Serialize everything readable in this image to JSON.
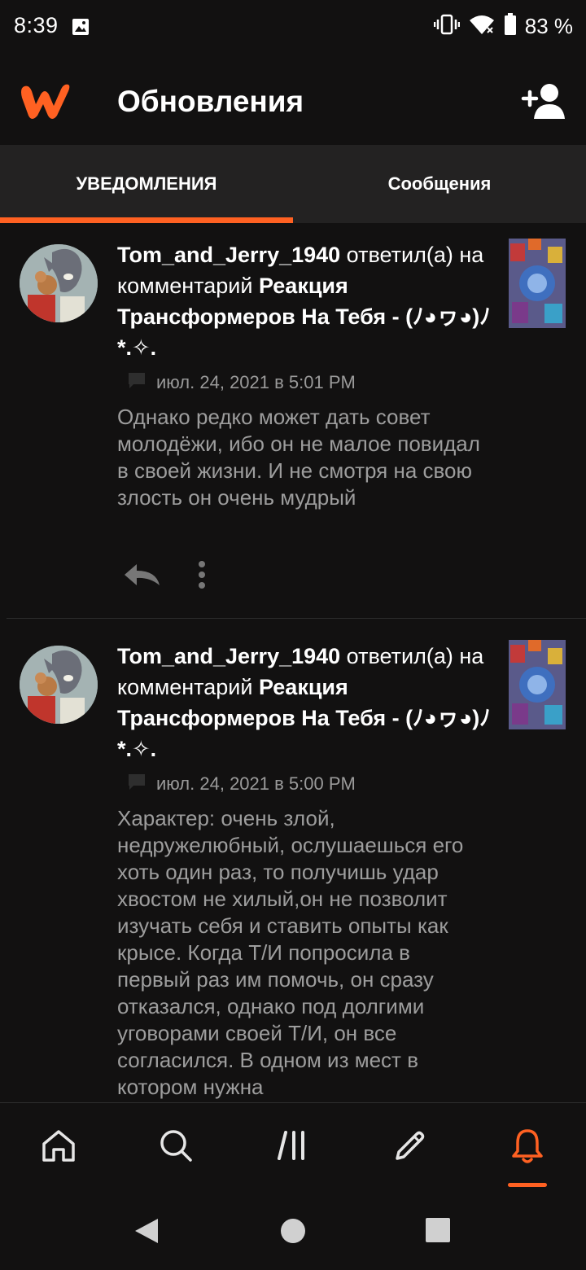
{
  "status_bar": {
    "time": "8:39",
    "battery": "83 %"
  },
  "app_bar": {
    "title": "Обновления",
    "logo_icon": "wattpad-logo",
    "action_icon": "add-user-icon"
  },
  "tabs": [
    {
      "label": "УВЕДОМЛЕНИЯ",
      "active": true
    },
    {
      "label": "Сообщения",
      "active": false
    }
  ],
  "notifications": [
    {
      "user": "Tom_and_Jerry_1940",
      "action": " ответил(а) на комментарий ",
      "story": "Реакция Трансформеров На Тебя - (ﾉ◕ヮ◕)ﾉ*.✧.",
      "timestamp": "июл. 24, 2021 в 5:01 PM",
      "text": "Однако редко может дать совет молодёжи, ибо он не малое повидал в своей жизни. И не смотря на свою злость он очень мудрый"
    },
    {
      "user": "Tom_and_Jerry_1940",
      "action": " ответил(а) на комментарий ",
      "story": "Реакция Трансформеров На Тебя - (ﾉ◕ヮ◕)ﾉ*.✧.",
      "timestamp": "июл. 24, 2021 в 5:00 PM",
      "text": "Характер: очень злой, недружелюбный, ослушаешься его хоть один раз, то получишь удар хвостом не хилый,он не позволит изучать себя и ставить опыты как крысе. Когда Т/И попросила в первый раз им помочь, он сразу отказался, однако под долгими уговорами своей Т/И, он все согласился. В одном из мест в котором нужна"
    }
  ],
  "bottom_nav": [
    {
      "icon": "home-icon",
      "active": false
    },
    {
      "icon": "search-icon",
      "active": false
    },
    {
      "icon": "library-icon",
      "active": false
    },
    {
      "icon": "pencil-icon",
      "active": false
    },
    {
      "icon": "bell-icon",
      "active": true
    }
  ],
  "colors": {
    "accent": "#ff6122",
    "background": "#121111",
    "tab_bar": "#232222",
    "muted_text": "#9d9d9d"
  }
}
